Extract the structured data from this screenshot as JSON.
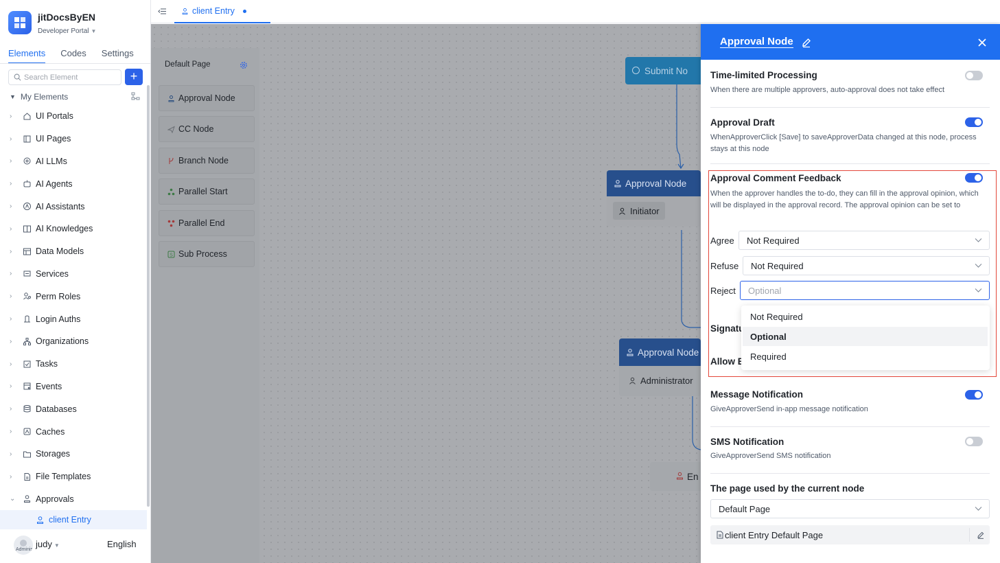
{
  "app": {
    "name": "jitDocsByEN",
    "portal": "Developer Portal"
  },
  "sidebar": {
    "tabs": [
      "Elements",
      "Codes",
      "Settings"
    ],
    "search_placeholder": "Search Element",
    "add_label": "+",
    "section_label": "My Elements",
    "items": [
      {
        "label": "UI Portals",
        "icon": "home-icon"
      },
      {
        "label": "UI Pages",
        "icon": "page-icon"
      },
      {
        "label": "AI LLMs",
        "icon": "llm-icon"
      },
      {
        "label": "AI Agents",
        "icon": "robot-icon"
      },
      {
        "label": "AI Assistants",
        "icon": "assistant-icon"
      },
      {
        "label": "AI Knowledges",
        "icon": "book-icon"
      },
      {
        "label": "Data Models",
        "icon": "table-icon"
      },
      {
        "label": "Services",
        "icon": "service-icon"
      },
      {
        "label": "Perm Roles",
        "icon": "roles-icon"
      },
      {
        "label": "Login Auths",
        "icon": "login-icon"
      },
      {
        "label": "Organizations",
        "icon": "org-icon"
      },
      {
        "label": "Tasks",
        "icon": "task-icon"
      },
      {
        "label": "Events",
        "icon": "event-icon"
      },
      {
        "label": "Databases",
        "icon": "database-icon"
      },
      {
        "label": "Caches",
        "icon": "cache-icon"
      },
      {
        "label": "Storages",
        "icon": "storage-icon"
      },
      {
        "label": "File Templates",
        "icon": "file-template-icon"
      },
      {
        "label": "Approvals",
        "icon": "approval-icon"
      }
    ],
    "sub_item": "client Entry",
    "user": {
      "name": "judy",
      "role": "Administrator"
    },
    "language": "English"
  },
  "topbar": {
    "tab_label": "client Entry"
  },
  "canvas": {
    "palette_title": "Default Page",
    "palette_items": [
      {
        "label": "Approval Node",
        "icon": "person-icon"
      },
      {
        "label": "CC Node",
        "icon": "send-icon"
      },
      {
        "label": "Branch Node",
        "icon": "branch-icon"
      },
      {
        "label": "Parallel Start",
        "icon": "parallel-start-icon"
      },
      {
        "label": "Parallel End",
        "icon": "parallel-end-icon"
      },
      {
        "label": "Sub Process",
        "icon": "subprocess-icon"
      }
    ],
    "nodes": {
      "submit": "Submit No",
      "approval1": {
        "title": "Approval Node",
        "assignee": "Initiator"
      },
      "approval2": {
        "title": "Approval Node",
        "assignee": "Administrator"
      },
      "end": "En"
    }
  },
  "panel": {
    "title": "Approval Node",
    "time_limited": {
      "title": "Time-limited Processing",
      "desc": "When there are multiple approvers, auto-approval does not take effect",
      "enabled": false
    },
    "approval_draft": {
      "title": "Approval Draft",
      "desc": "WhenApproverClick [Save] to saveApproverData changed at this node, process stays at this node",
      "enabled": true
    },
    "comment_feedback": {
      "title": "Approval Comment Feedback",
      "desc": "When the approver handles the to-do, they can fill in the approval opinion, which will be displayed in the approval record. The approval opinion can be set to",
      "enabled": true,
      "agree_label": "Agree",
      "agree_value": "Not Required",
      "refuse_label": "Refuse",
      "refuse_value": "Not Required",
      "reject_label": "Reject",
      "reject_placeholder": "Optional",
      "options": [
        "Not Required",
        "Optional",
        "Required"
      ],
      "highlighted_option": "Optional"
    },
    "hidden_rows": {
      "signature": "Signatu",
      "allow": "Allow E"
    },
    "message_notification": {
      "title": "Message Notification",
      "desc": "GiveApproverSend in-app message notification",
      "enabled": true
    },
    "sms_notification": {
      "title": "SMS Notification",
      "desc": "GiveApproverSend SMS notification",
      "enabled": false
    },
    "page_used": {
      "title": "The page used by the current node",
      "value": "Default Page",
      "link_text": "client Entry Default Page"
    }
  },
  "colors": {
    "accent": "#1f6ff0",
    "highlight_border": "#e4473a"
  }
}
